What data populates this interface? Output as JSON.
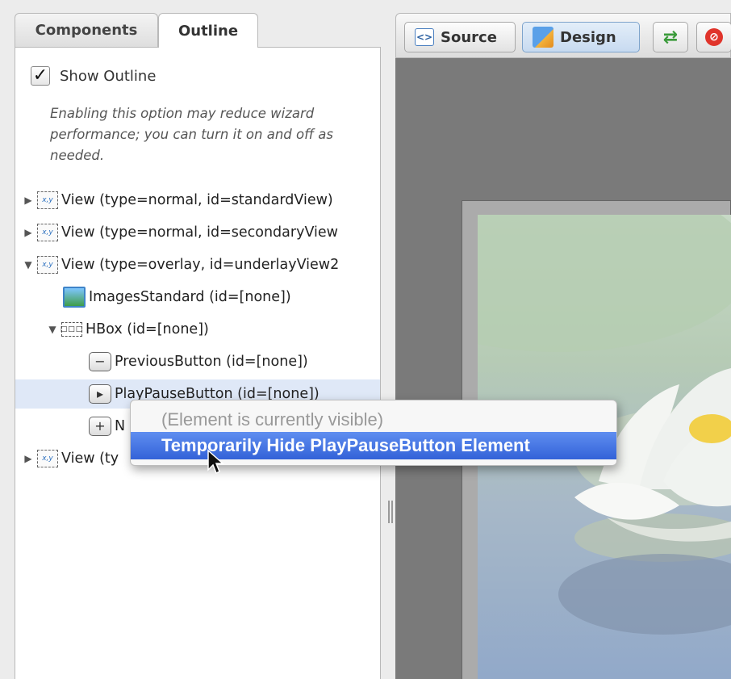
{
  "tabs": {
    "components": "Components",
    "outline": "Outline"
  },
  "show_outline": {
    "label": "Show Outline",
    "checked": "✓"
  },
  "hint": "Enabling this option may reduce wizard performance; you can turn it on and off as needed.",
  "tree": {
    "view_icon_text": "x,y",
    "hbox_icon_text": "□□□",
    "rows": [
      {
        "arrow": "▶",
        "label": "View (type=normal, id=standardView)"
      },
      {
        "arrow": "▶",
        "label": "View (type=normal, id=secondaryView"
      },
      {
        "arrow": "▼",
        "label": "View (type=overlay, id=underlayView2"
      },
      {
        "label": "ImagesStandard (id=[none])"
      },
      {
        "arrow": "▼",
        "label": "HBox (id=[none])"
      },
      {
        "icon": "−",
        "label": "PreviousButton (id=[none])"
      },
      {
        "icon": "▸",
        "label": "PlayPauseButton (id=[none])"
      },
      {
        "icon": "+",
        "label": "N"
      },
      {
        "arrow": "▶",
        "label": "View (ty"
      }
    ]
  },
  "toolbar": {
    "source_label": "Source",
    "source_icon_text": "<>",
    "design_label": "Design",
    "refresh_glyph": "⇄",
    "stop_glyph": "⊘"
  },
  "context_menu": {
    "status": "(Element is currently visible)",
    "action": "Temporarily Hide PlayPauseButton Element"
  },
  "colors": {
    "menu_highlight": "#3f6fe0",
    "selected_row": "#dfe8f7"
  }
}
